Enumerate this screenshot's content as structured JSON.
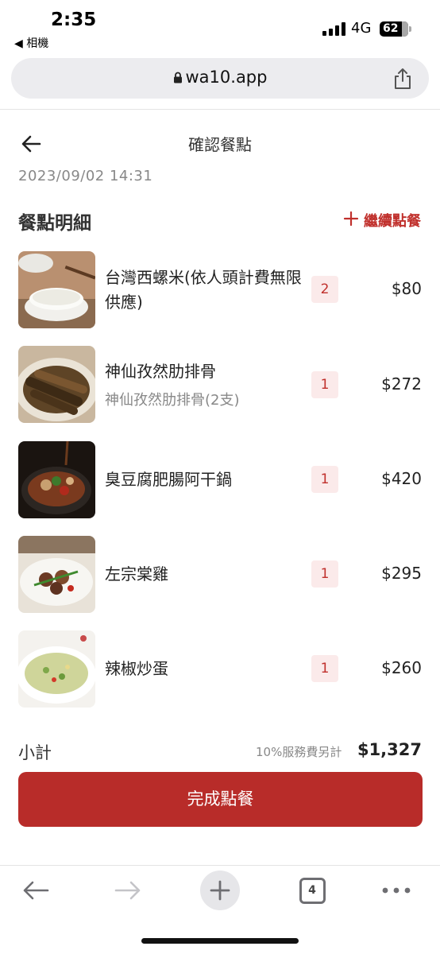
{
  "status_bar": {
    "time": "2:35",
    "back_app": "◀ 相機",
    "network": "4G",
    "battery": "62"
  },
  "browser": {
    "url": "wa10.app"
  },
  "header": {
    "title": "確認餐點",
    "order_time": "2023/09/02 14:31"
  },
  "section": {
    "title": "餐點明細",
    "continue_label": "繼續點餐"
  },
  "items": [
    {
      "name": "台灣西螺米(依人頭計費無限供應)",
      "sub": "",
      "qty": "2",
      "price": "$80",
      "image": "rice-bowl"
    },
    {
      "name": "神仙孜然肋排骨",
      "sub": "神仙孜然肋排骨(2支)",
      "qty": "1",
      "price": "$272",
      "image": "cumin-ribs"
    },
    {
      "name": "臭豆腐肥腸阿干鍋",
      "sub": "",
      "qty": "1",
      "price": "$420",
      "image": "stinky-tofu-pot"
    },
    {
      "name": "左宗棠雞",
      "sub": "",
      "qty": "1",
      "price": "$295",
      "image": "general-tso-chicken"
    },
    {
      "name": "辣椒炒蛋",
      "sub": "",
      "qty": "1",
      "price": "$260",
      "image": "chili-egg"
    }
  ],
  "summary": {
    "label": "小計",
    "service_note": "10%服務費另計",
    "total": "$1,327"
  },
  "submit_label": "完成點餐",
  "bottom_bar": {
    "tab_count": "4"
  },
  "colors": {
    "accent": "#b82c29",
    "accent_text": "#c0302c",
    "qty_bg": "#fbeaea"
  }
}
